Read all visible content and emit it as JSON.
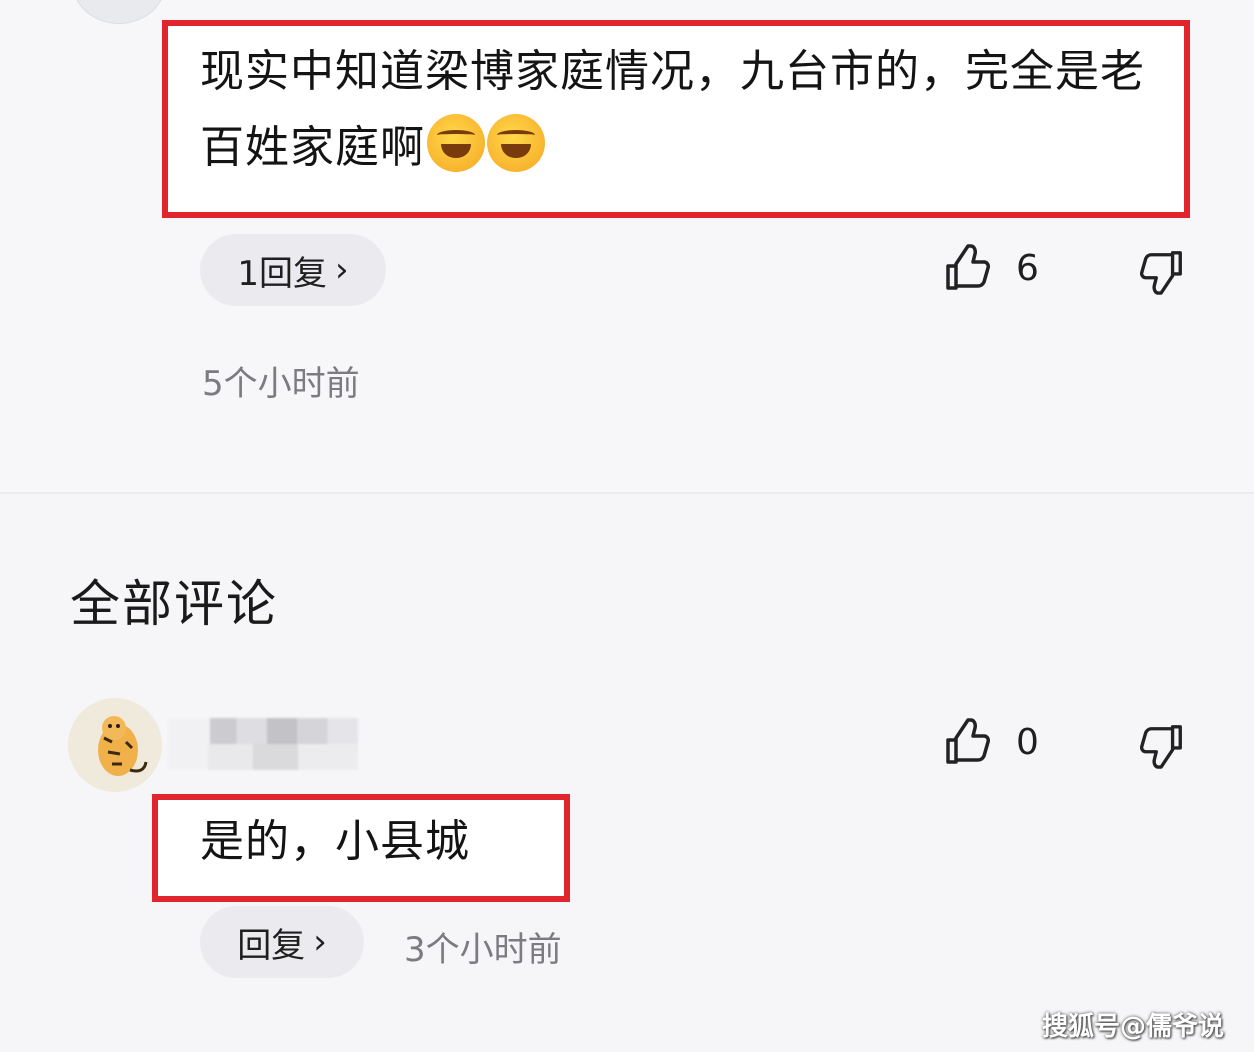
{
  "top_comment": {
    "text": "现实中知道梁博家庭情况，九台市的，完全是老百姓家庭啊",
    "emojis": [
      "laugh-cry-emoji",
      "laugh-cry-emoji"
    ],
    "reply_button_label": "1回复",
    "like_count": "6",
    "time": "5个小时前"
  },
  "section_heading": "全部评论",
  "comment_2": {
    "avatar_icon": "tiger-avatar",
    "text": "是的，小县城",
    "reply_button_label": "回复",
    "like_count": "0",
    "time": "3个小时前"
  },
  "watermark": "搜狐号@儒爷说",
  "colors": {
    "highlight_border": "#e0262c",
    "pill_bg": "#ebebef",
    "time_text": "#7b7b82"
  }
}
